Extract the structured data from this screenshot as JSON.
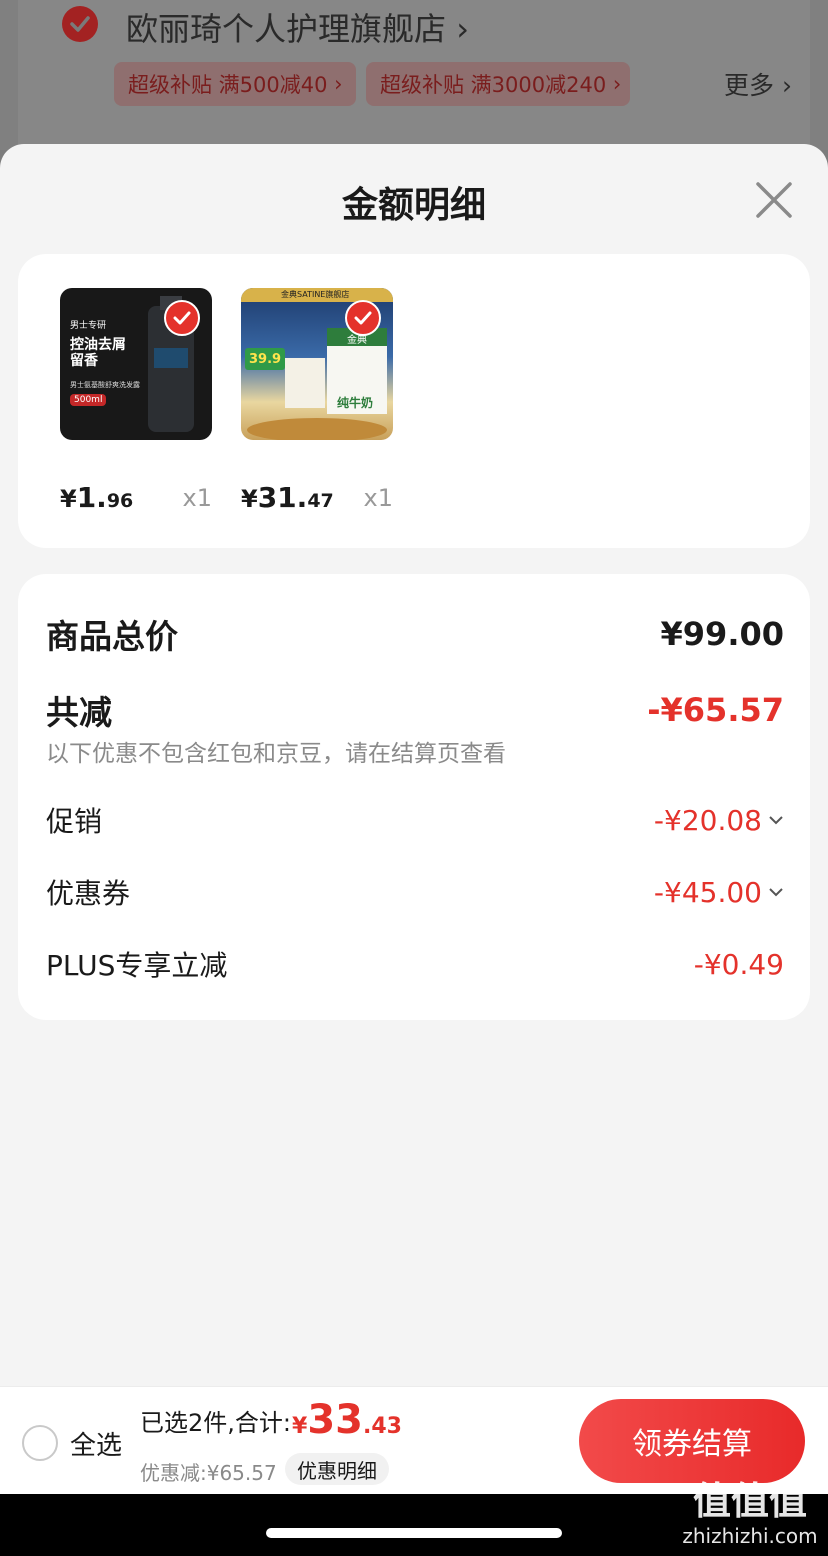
{
  "background_page": {
    "store_name": "欧丽琦个人护理旗舰店",
    "promo_tags": [
      "超级补贴 满500减40",
      "超级补贴 满3000减240"
    ],
    "more_label": "更多"
  },
  "sheet": {
    "title": "金额明细",
    "products": [
      {
        "price_yen": "¥",
        "price_int": "1.",
        "price_dec": "96",
        "qty": "x1",
        "thumb_lines": [
          "男士专研",
          "控油去屑",
          "留香",
          "男士氨基酸舒爽洗发露",
          "500ml"
        ]
      },
      {
        "price_yen": "¥",
        "price_int": "31.",
        "price_dec": "47",
        "qty": "x1",
        "thumb_lines": [
          "金典SATINE旗舰店",
          "39.9",
          "纯牛奶",
          "金典"
        ]
      }
    ],
    "summary": {
      "total_label": "商品总价",
      "total_value": "¥99.00",
      "reduce_label": "共减",
      "reduce_value": "-¥65.57",
      "reduce_note": "以下优惠不包含红包和京豆，请在结算页查看",
      "items": [
        {
          "label": "促销",
          "value": "-¥20.08"
        },
        {
          "label": "优惠券",
          "value": "-¥45.00"
        },
        {
          "label": "PLUS专享立减",
          "value": "-¥0.49"
        }
      ]
    }
  },
  "bottom_bar": {
    "select_all": "全选",
    "selected_text": "已选2件,合计:",
    "total_yen": "¥",
    "total_int": "33",
    "total_dec": ".43",
    "discount_text": "优惠减:¥65.57",
    "detail_button": "优惠明细",
    "checkout_button": "领券结算"
  },
  "watermark": {
    "text": "值值值",
    "site": "zhizhizhi.com"
  },
  "colors": {
    "accent_red": "#e4322b",
    "sheet_bg": "#f4f4f4"
  }
}
